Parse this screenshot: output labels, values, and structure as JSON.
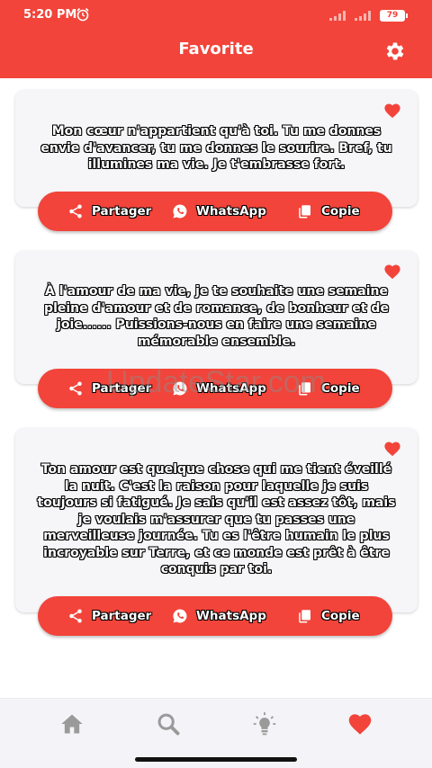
{
  "status": {
    "time": "5:20 PM",
    "battery": "79"
  },
  "header": {
    "title": "Favorite"
  },
  "quotes": [
    {
      "text": "Mon cœur n'appartient qu'à toi. Tu me donnes envie d'avancer, tu me donnes le sourire. Bref, tu illumines ma vie. Je t'embrasse fort."
    },
    {
      "text": "À l'amour de ma vie, je te souhaite une semaine pleine d'amour et de romance, de bonheur et de joie...... Puissions-nous en faire une semaine mémorable ensemble."
    },
    {
      "text": "Ton amour est quelque chose qui me tient éveillé la nuit. C'est la raison pour laquelle je suis toujours si fatigué. Je sais qu'il est assez tôt, mais je voulais m'assurer que tu passes une merveilleuse journée. Tu es l'être humain le plus incroyable sur Terre, et ce monde est prêt à être conquis par toi."
    }
  ],
  "actions": {
    "share": "Partager",
    "whatsapp": "WhatsApp",
    "copy": "Copie"
  },
  "watermark": "UpdateStar.com",
  "nav": [
    "home-icon",
    "search-icon",
    "lightbulb-icon",
    "heart-icon"
  ],
  "colors": {
    "accent": "#f2443a",
    "card": "#f6f5f8",
    "nav_inactive": "#9a9a9a"
  }
}
